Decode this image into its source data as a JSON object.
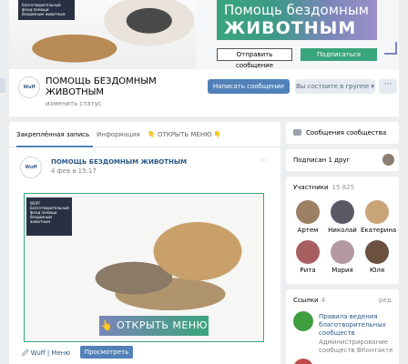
{
  "cover": {
    "logo_text": "Благотворительный фонд помощи бездомным животным",
    "banner_line1": "Помощь бездомным",
    "banner_line2": "ЖИВОТНЫМ",
    "send_message": "Отправить сообщение",
    "subscribe": "Подписаться"
  },
  "header": {
    "avatar_text": "Wuff",
    "title": "ПОМОЩЬ БЕЗДОМНЫМ ЖИВОТНЫМ",
    "status": "изменить статус",
    "btn_message": "Написать сообщение",
    "btn_member": "Вы состоите в группе ▾",
    "btn_more": "···"
  },
  "tabs": {
    "pinned": "Закреплённая запись",
    "info": "Информация",
    "menu": "👇 ОТКРЫТЬ МЕНЮ 👇"
  },
  "post": {
    "avatar_text": "Wuff",
    "author": "ПОМОЩЬ БЕЗДОМНЫМ ЖИВОТНЫМ",
    "date": "4 фев в 15:17",
    "more": "···",
    "image_logo": "WUFF Благотворительный фонд помощи бездомным животным",
    "image_button": "👆 ОТКРЫТЬ МЕНЮ",
    "link": "🖉 Wuff | Меню",
    "view_button": "Просмотреть"
  },
  "sidebar": {
    "messages": "Сообщения сообщества",
    "friends": "Подписан 1 друг",
    "members_title": "Участники",
    "members_count": "15 825",
    "members": [
      {
        "name": "Артем",
        "color": "#9c8064"
      },
      {
        "name": "Николай",
        "color": "#5a5a66"
      },
      {
        "name": "Екатерина",
        "color": "#c8a477"
      },
      {
        "name": "Рита",
        "color": "#a85f5f"
      },
      {
        "name": "Мария",
        "color": "#b49aa0"
      },
      {
        "name": "Юля",
        "color": "#6d5140"
      }
    ],
    "links_title": "Ссылки",
    "links_count": "4",
    "links_edit": "ред.",
    "link1_title": "Правила ведения благотворительных сообществ",
    "link1_desc": "Администрирование сообществ ВКонтакте"
  },
  "colors": {
    "accent": "#5181b8",
    "brand_green": "#3aa57c",
    "brand_purple": "#7a86b8"
  }
}
